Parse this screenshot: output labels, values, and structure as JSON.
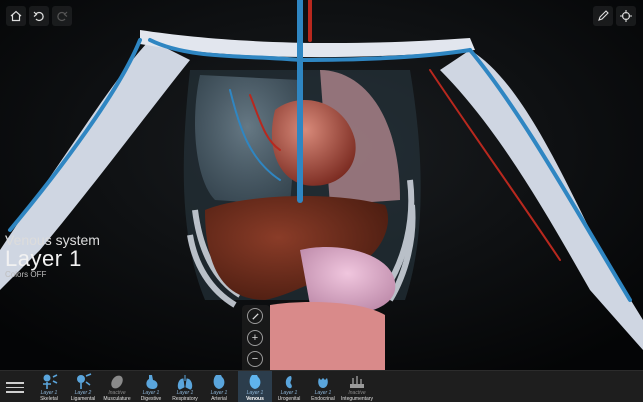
{
  "toolbar": {
    "home_icon": "home-icon",
    "undo_icon": "undo-icon",
    "redo_icon": "redo-icon",
    "pencil_icon": "pencil-icon",
    "target_icon": "crosshair-icon"
  },
  "layer_info": {
    "system": "Venous system",
    "layer": "Layer 1",
    "colors": "Colors OFF"
  },
  "side_tools": {
    "slice_icon": "slice-icon",
    "plus": "+",
    "minus": "−"
  },
  "colors": {
    "vein": "#2f86c2",
    "artery": "#b8281e",
    "bone": "#d9dde6",
    "liver": "#6b2c1c",
    "bar": "#1e1e1e",
    "active": "#2c3d4c"
  },
  "systems": [
    {
      "layer": "Layer 1",
      "name": "Skeletal",
      "icon": "skeleton-icon"
    },
    {
      "layer": "Layer 2",
      "name": "Ligamental",
      "icon": "ligament-icon"
    },
    {
      "layer": "Inactive",
      "name": "Musculature",
      "icon": "muscle-icon"
    },
    {
      "layer": "Layer 1",
      "name": "Digestive",
      "icon": "stomach-icon"
    },
    {
      "layer": "Layer 1",
      "name": "Respiratory",
      "icon": "lungs-icon"
    },
    {
      "layer": "Layer 1",
      "name": "Arterial",
      "icon": "artery-icon"
    },
    {
      "layer": "Layer 1",
      "name": "Venous",
      "icon": "vein-icon"
    },
    {
      "layer": "Layer 1",
      "name": "Urogenital",
      "icon": "kidney-icon"
    },
    {
      "layer": "Layer 1",
      "name": "Endocrinal",
      "icon": "gland-icon"
    },
    {
      "layer": "Inactive",
      "name": "Integumentary",
      "icon": "skin-icon"
    }
  ]
}
